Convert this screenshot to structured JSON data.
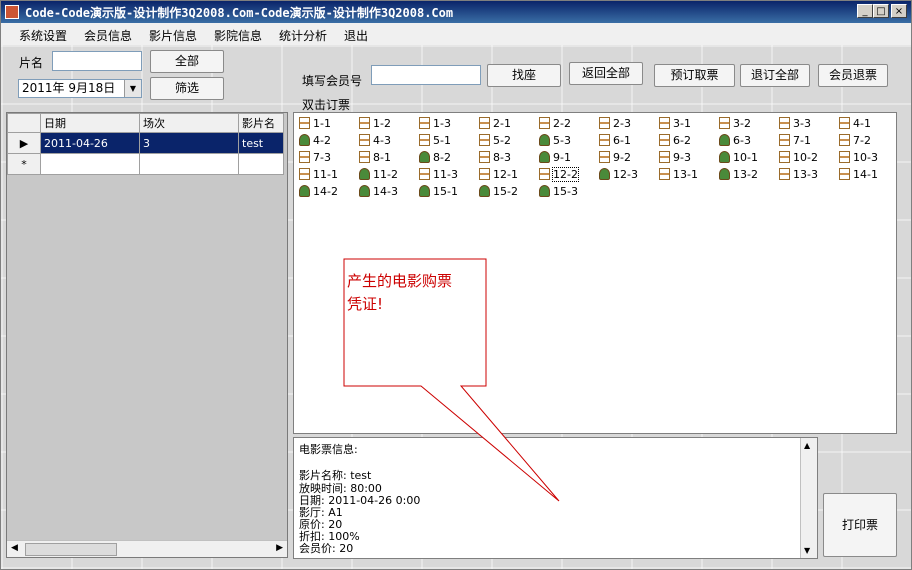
{
  "window": {
    "title": "Code-Code演示版-设计制作3Q2008.Com-Code演示版-设计制作3Q2008.Com",
    "controls": {
      "minimize": "_",
      "maximize": "□",
      "close": "×"
    }
  },
  "menu": [
    "系统设置",
    "会员信息",
    "影片信息",
    "影院信息",
    "统计分析",
    "退出"
  ],
  "filter": {
    "film_label": "片名",
    "film_value": "",
    "date_value": "2011年  9月18日",
    "all_button": "全部",
    "filter_button": "筛选"
  },
  "toolbar": {
    "member_label": "填写会员号",
    "member_value": "",
    "hint": "双击订票",
    "buttons": [
      "找座",
      "返回全部",
      "预订取票",
      "退订全部",
      "会员退票"
    ]
  },
  "grid": {
    "columns": [
      "日期",
      "场次",
      "影片名"
    ],
    "rows": [
      {
        "marker": "▶",
        "cells": [
          "2011-04-26",
          "3",
          "test"
        ]
      }
    ],
    "new_row_marker": "*"
  },
  "seats": [
    {
      "label": "1-1",
      "status": "empty"
    },
    {
      "label": "1-2",
      "status": "empty"
    },
    {
      "label": "1-3",
      "status": "empty"
    },
    {
      "label": "2-1",
      "status": "empty"
    },
    {
      "label": "2-2",
      "status": "empty"
    },
    {
      "label": "2-3",
      "status": "empty"
    },
    {
      "label": "3-1",
      "status": "empty"
    },
    {
      "label": "3-2",
      "status": "empty"
    },
    {
      "label": "3-3",
      "status": "empty"
    },
    {
      "label": "4-1",
      "status": "empty"
    },
    {
      "label": "4-2",
      "status": "occupied"
    },
    {
      "label": "4-3",
      "status": "empty"
    },
    {
      "label": "5-1",
      "status": "empty"
    },
    {
      "label": "5-2",
      "status": "empty"
    },
    {
      "label": "5-3",
      "status": "occupied"
    },
    {
      "label": "6-1",
      "status": "empty"
    },
    {
      "label": "6-2",
      "status": "empty"
    },
    {
      "label": "6-3",
      "status": "occupied"
    },
    {
      "label": "7-1",
      "status": "empty"
    },
    {
      "label": "7-2",
      "status": "empty"
    },
    {
      "label": "7-3",
      "status": "empty"
    },
    {
      "label": "8-1",
      "status": "empty"
    },
    {
      "label": "8-2",
      "status": "occupied"
    },
    {
      "label": "8-3",
      "status": "empty"
    },
    {
      "label": "9-1",
      "status": "occupied"
    },
    {
      "label": "9-2",
      "status": "empty"
    },
    {
      "label": "9-3",
      "status": "empty"
    },
    {
      "label": "10-1",
      "status": "occupied"
    },
    {
      "label": "10-2",
      "status": "empty"
    },
    {
      "label": "10-3",
      "status": "empty"
    },
    {
      "label": "11-1",
      "status": "empty"
    },
    {
      "label": "11-2",
      "status": "occupied"
    },
    {
      "label": "11-3",
      "status": "empty"
    },
    {
      "label": "12-1",
      "status": "empty"
    },
    {
      "label": "12-2",
      "status": "empty",
      "focus": true
    },
    {
      "label": "12-3",
      "status": "occupied"
    },
    {
      "label": "13-1",
      "status": "empty"
    },
    {
      "label": "13-2",
      "status": "occupied"
    },
    {
      "label": "13-3",
      "status": "empty"
    },
    {
      "label": "14-1",
      "status": "empty"
    },
    {
      "label": "14-2",
      "status": "occupied"
    },
    {
      "label": "14-3",
      "status": "occupied"
    },
    {
      "label": "15-1",
      "status": "occupied"
    },
    {
      "label": "15-2",
      "status": "occupied"
    },
    {
      "label": "15-3",
      "status": "occupied"
    }
  ],
  "ticket": {
    "lines": [
      "电影票信息:",
      "",
      "影片名称:  test",
      "放映时间:  80:00",
      "日期:  2011-04-26 0:00",
      "影厅:  A1",
      "原价:  20",
      "折扣:  100%",
      "会员价:  20"
    ]
  },
  "print_button": "打印票",
  "callout": {
    "line1": "产生的电影购票",
    "line2": "凭证!"
  }
}
